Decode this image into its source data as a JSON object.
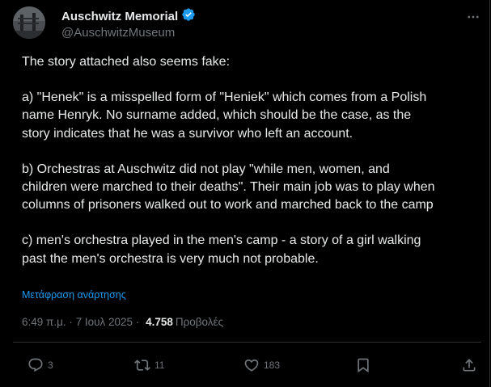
{
  "author": {
    "display_name": "Auschwitz Memorial",
    "handle": "@AuschwitzMuseum",
    "verified_icon": "verified-badge-icon"
  },
  "post": {
    "lines": [
      "The story attached also seems fake:",
      "",
      "a) \"Henek\" is a misspelled form of \"Heniek\" which comes from a Polish",
      "name Henryk. No surname added, which should be the case, as the",
      "story indicates that he was a survivor who left an account.",
      "",
      "b) Orchestras at Auschwitz did not play \"while men, women, and",
      "children were marched to their deaths\". Their main job was to play when",
      "columns of prisoners walked out to work and marched back to the camp",
      "",
      "c) men's orchestra played in the men's camp - a story of a girl walking",
      "past the men's orchestra is very much not probable."
    ],
    "translate_label": "Μετάφραση ανάρτησης"
  },
  "meta": {
    "time": "6:49 π.μ.",
    "sep1": " · ",
    "date": "7 Ιουλ 2025",
    "sep2": " · ",
    "views_count": "4.758",
    "views_label": "Προβολές"
  },
  "actions": {
    "replies": "3",
    "reposts": "11",
    "likes": "183"
  },
  "colors": {
    "background": "#000000",
    "text": "#e7e9ea",
    "secondary": "#71767b",
    "accent": "#1d9bf0",
    "divider": "#2f3336"
  }
}
